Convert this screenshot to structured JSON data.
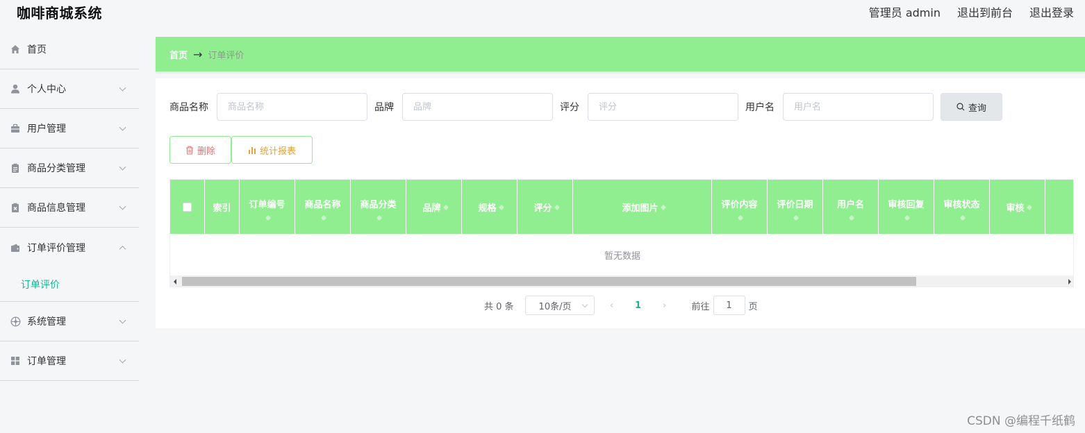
{
  "header": {
    "app_title": "咖啡商城系统",
    "admin_label": "管理员 admin",
    "back_to_front": "退出到前台",
    "logout": "退出登录"
  },
  "sidebar": {
    "items": [
      {
        "label": "首页",
        "icon": "home-icon"
      },
      {
        "label": "个人中心",
        "icon": "user-icon"
      },
      {
        "label": "用户管理",
        "icon": "briefcase-icon"
      },
      {
        "label": "商品分类管理",
        "icon": "clipboard-icon"
      },
      {
        "label": "商品信息管理",
        "icon": "clipboard-x-icon"
      },
      {
        "label": "订单评价管理",
        "icon": "wallet-icon"
      },
      {
        "label": "系统管理",
        "icon": "compass-icon"
      },
      {
        "label": "订单管理",
        "icon": "grid-icon"
      }
    ],
    "active_sub": "订单评价"
  },
  "breadcrumb": {
    "home": "首页",
    "arrow": "→",
    "current": "订单评价"
  },
  "search": {
    "product_name_label": "商品名称",
    "product_name_placeholder": "商品名称",
    "brand_label": "品牌",
    "brand_placeholder": "品牌",
    "rating_label": "评分",
    "rating_placeholder": "评分",
    "username_label": "用户名",
    "username_placeholder": "用户名",
    "query_button": "查询"
  },
  "actions": {
    "delete": "删除",
    "stats": "统计报表"
  },
  "table": {
    "columns": [
      "索引",
      "订单编号",
      "商品名称",
      "商品分类",
      "品牌",
      "规格",
      "评分",
      "添加图片",
      "评价内容",
      "评价日期",
      "用户名",
      "审核回复",
      "审核状态",
      "审核"
    ],
    "empty_text": "暂无数据"
  },
  "pagination": {
    "total": "共 0 条",
    "page_size": "10条/页",
    "prev": "‹",
    "current_page": "1",
    "next": "›",
    "goto_label": "前往",
    "goto_value": "1",
    "page_suffix": "页"
  },
  "watermark": "CSDN @编程千纸鹤",
  "colors": {
    "accent_green": "#90ee90",
    "teal": "#1ab394",
    "delete_red": "#f56c6c",
    "stats_orange": "#e6a23c"
  }
}
